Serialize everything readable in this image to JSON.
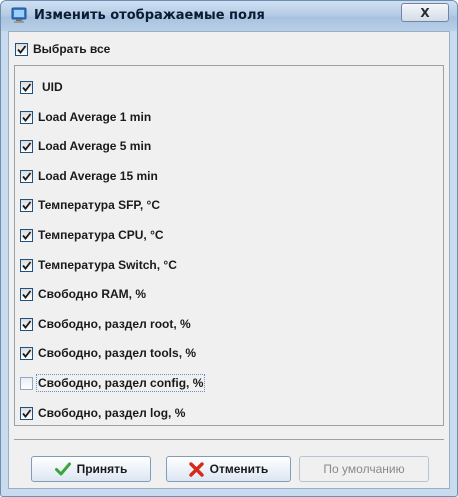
{
  "window": {
    "title": "Изменить отображаемые поля",
    "close_symbol": "X"
  },
  "select_all": {
    "label": "Выбрать все",
    "checked": true
  },
  "fields": [
    {
      "label": "UID",
      "checked": true
    },
    {
      "label": "Load Average 1 min",
      "checked": true
    },
    {
      "label": "Load Average 5 min",
      "checked": true
    },
    {
      "label": "Load Average 15 min",
      "checked": true
    },
    {
      "label": "Температура SFP, °C",
      "checked": true
    },
    {
      "label": "Температура CPU, °C",
      "checked": true
    },
    {
      "label": "Температура Switch, °C",
      "checked": true
    },
    {
      "label": "Свободно RAM, %",
      "checked": true
    },
    {
      "label": "Свободно, раздел root, %",
      "checked": true
    },
    {
      "label": "Свободно, раздел tools, %",
      "checked": true
    },
    {
      "label": "Свободно, раздел config, %",
      "checked": false
    },
    {
      "label": "Свободно, раздел log, %",
      "checked": true
    }
  ],
  "buttons": {
    "accept": {
      "label": "Принять",
      "icon": "checkmark-icon",
      "color": "#3aa53a"
    },
    "cancel": {
      "label": "Отменить",
      "icon": "red-x-icon",
      "color": "#d42a1a"
    },
    "defaults": {
      "label": "По умолчанию",
      "enabled": false
    }
  }
}
